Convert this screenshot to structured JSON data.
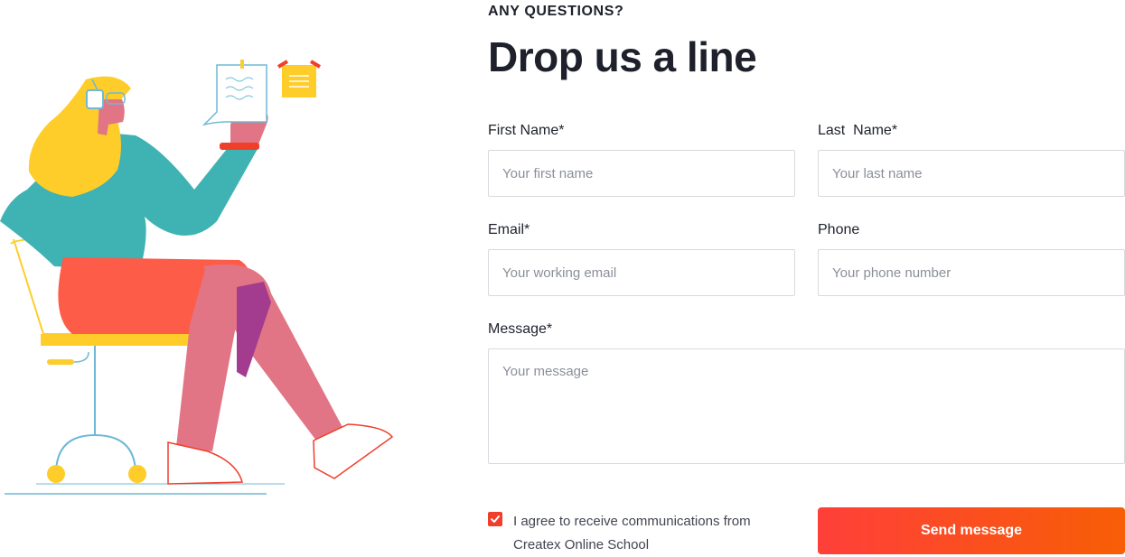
{
  "section": {
    "eyebrow": "ANY QUESTIONS?",
    "title": "Drop us a line"
  },
  "form": {
    "first_name": {
      "label": "First Name*",
      "placeholder": "Your first name"
    },
    "last_name": {
      "label": "Last  Name*",
      "placeholder": "Your last name"
    },
    "email": {
      "label": "Email*",
      "placeholder": "Your working email"
    },
    "phone": {
      "label": "Phone",
      "placeholder": "Your phone number"
    },
    "message": {
      "label": "Message*",
      "placeholder": "Your message"
    },
    "consent": {
      "text": "I agree to receive communications from Createx Online School",
      "checked": true
    },
    "submit_label": "Send message"
  },
  "colors": {
    "accent": "#ef3e2a",
    "gradient_start": "#ff3f3a",
    "gradient_end": "#f75e05",
    "text_dark": "#1e212c",
    "border": "#d7dade"
  },
  "illustration": {
    "icon": "woman-on-chair-illustration"
  }
}
